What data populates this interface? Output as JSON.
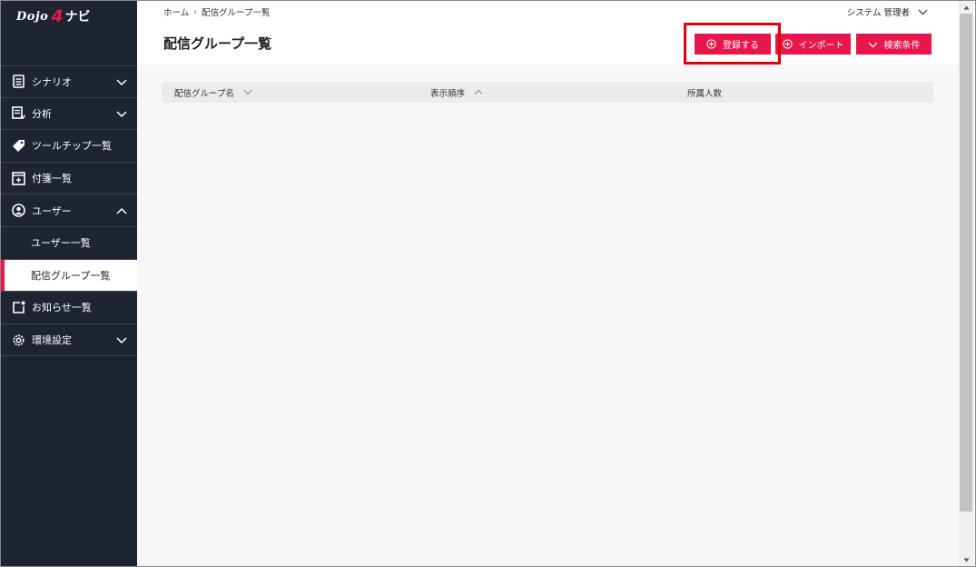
{
  "logo": {
    "word": "Dojo",
    "number": "4",
    "suffix": "ナビ"
  },
  "sidebar": {
    "items": [
      {
        "label": "シナリオ",
        "icon": "document-icon",
        "expandable": "down"
      },
      {
        "label": "分析",
        "icon": "analysis-icon",
        "expandable": "down"
      },
      {
        "label": "ツールチップ一覧",
        "icon": "tag-icon"
      },
      {
        "label": "付箋一覧",
        "icon": "sticky-note-icon"
      },
      {
        "label": "ユーザー",
        "icon": "user-circle-icon",
        "expandable": "up"
      },
      {
        "label": "ユーザー一覧",
        "sub": true
      },
      {
        "label": "配信グループ一覧",
        "sub": true,
        "active": true
      },
      {
        "label": "お知らせ一覧",
        "icon": "notice-icon"
      },
      {
        "label": "環境設定",
        "icon": "gear-icon",
        "expandable": "down"
      }
    ]
  },
  "breadcrumb": {
    "home": "ホーム",
    "current": "配信グループ一覧"
  },
  "header": {
    "user_name": "システム 管理者",
    "page_title": "配信グループ一覧"
  },
  "buttons": {
    "register": "登録する",
    "import": "インポート",
    "search": "検索条件"
  },
  "table": {
    "columns": [
      {
        "label": "配信グループ名",
        "sort": "chevron-down-icon"
      },
      {
        "label": "表示順序",
        "sort": "chevron-up-icon"
      },
      {
        "label": "所属人数"
      }
    ],
    "rows": []
  },
  "colors": {
    "accent": "#e8174b",
    "sidebar_bg": "#1f2433",
    "highlight": "#e0000f"
  }
}
